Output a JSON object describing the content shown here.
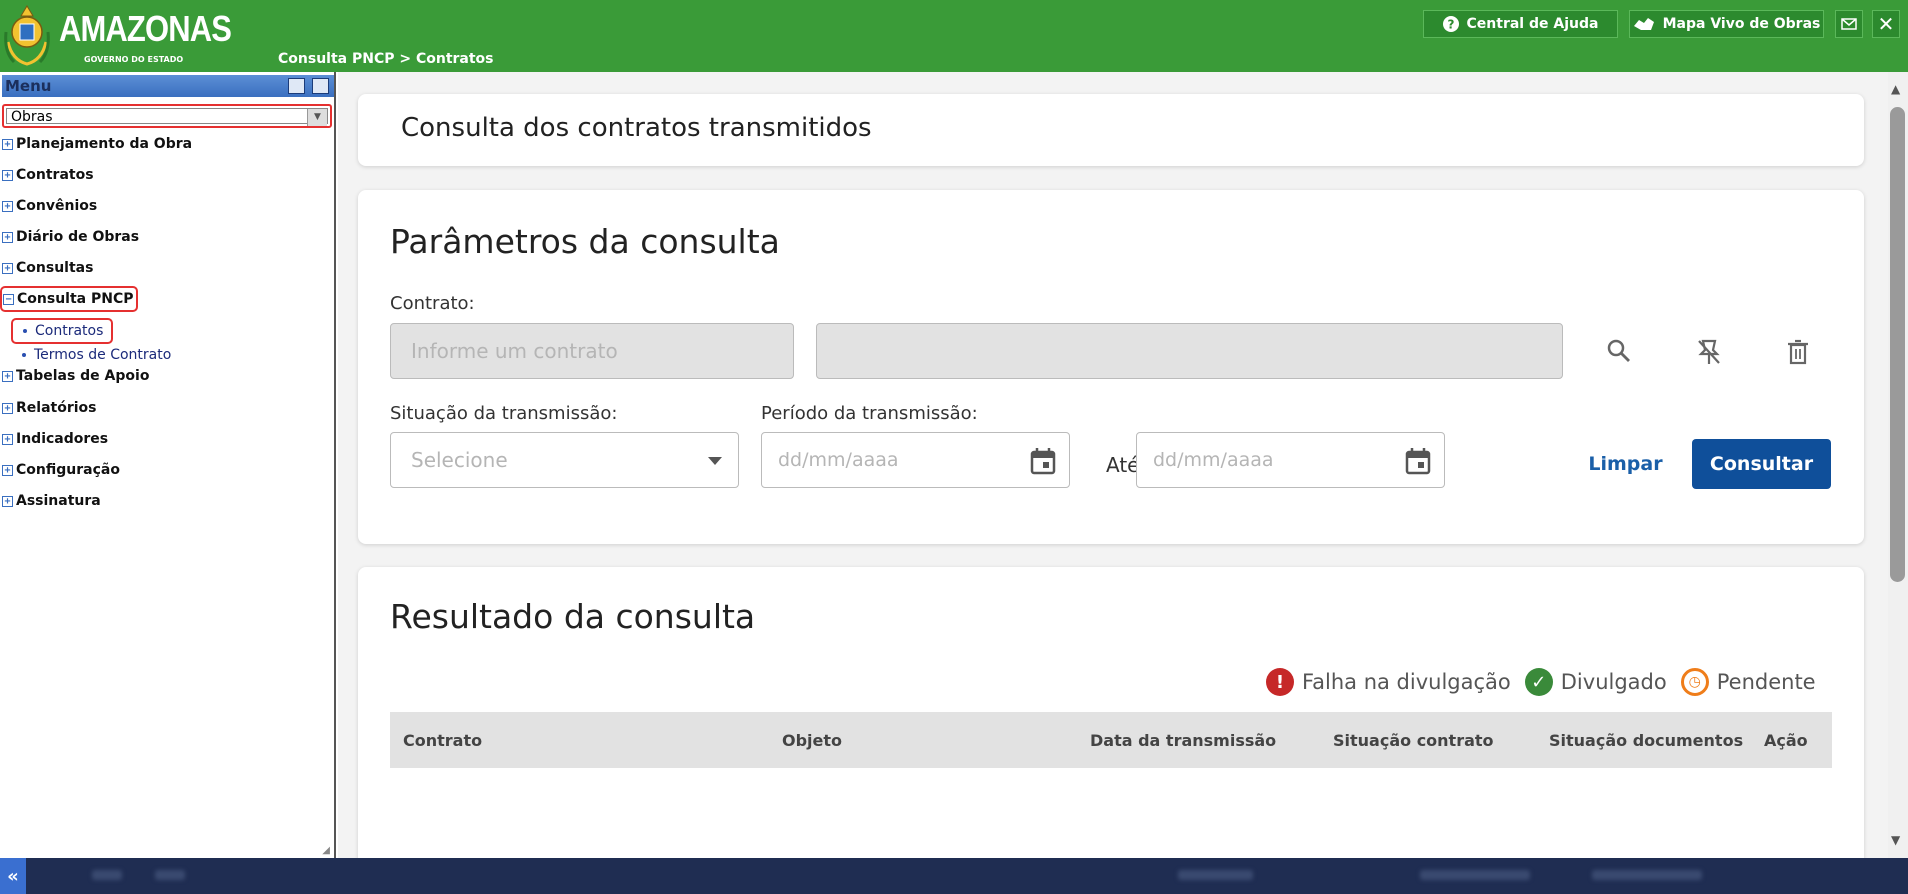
{
  "header": {
    "brand": "AMAZONAS",
    "brand_sub": "GOVERNO DO ESTADO",
    "breadcrumb": "Consulta PNCP > Contratos",
    "help_label": "Central de Ajuda",
    "map_label": "Mapa Vivo de Obras"
  },
  "sidebar": {
    "title": "Menu",
    "module_select": "Obras",
    "items": [
      {
        "label": "Planejamento da Obra",
        "state": "collapsed"
      },
      {
        "label": "Contratos",
        "state": "collapsed"
      },
      {
        "label": "Convênios",
        "state": "collapsed"
      },
      {
        "label": "Diário de Obras",
        "state": "collapsed"
      },
      {
        "label": "Consultas",
        "state": "collapsed"
      },
      {
        "label": "Consulta PNCP",
        "state": "expanded"
      },
      {
        "label": "Tabelas de Apoio",
        "state": "collapsed"
      },
      {
        "label": "Relatórios",
        "state": "collapsed"
      },
      {
        "label": "Indicadores",
        "state": "collapsed"
      },
      {
        "label": "Configuração",
        "state": "collapsed"
      },
      {
        "label": "Assinatura",
        "state": "collapsed"
      }
    ],
    "subitems": [
      {
        "label": "Contratos",
        "selected": true
      },
      {
        "label": "Termos de Contrato",
        "selected": false
      }
    ]
  },
  "main": {
    "page_title": "Consulta dos contratos transmitidos",
    "params_title": "Parâmetros da consulta",
    "contract_label": "Contrato:",
    "contract_placeholder": "Informe um contrato",
    "situation_label": "Situação da transmissão:",
    "situation_placeholder": "Selecione",
    "period_label": "Período da transmissão:",
    "date_placeholder": "dd/mm/aaaa",
    "until_label": "Até",
    "clear_label": "Limpar",
    "submit_label": "Consultar",
    "results_title": "Resultado da consulta",
    "legend": [
      {
        "label": "Falha na divulgação",
        "color": "#c62828",
        "icon": "exclamation-icon"
      },
      {
        "label": "Divulgado",
        "color": "#3a8a3a",
        "icon": "check-icon"
      },
      {
        "label": "Pendente",
        "color": "#ef7d1a",
        "icon": "clock-icon"
      }
    ],
    "table_headers": [
      "Contrato",
      "Objeto",
      "Data da transmissão",
      "Situação contrato",
      "Situação documentos",
      "Ação"
    ]
  },
  "colors": {
    "topbar": "#3a9b38",
    "primary": "#0f4f9a",
    "highlight": "#e53030",
    "bottombar": "#1f2d52"
  }
}
